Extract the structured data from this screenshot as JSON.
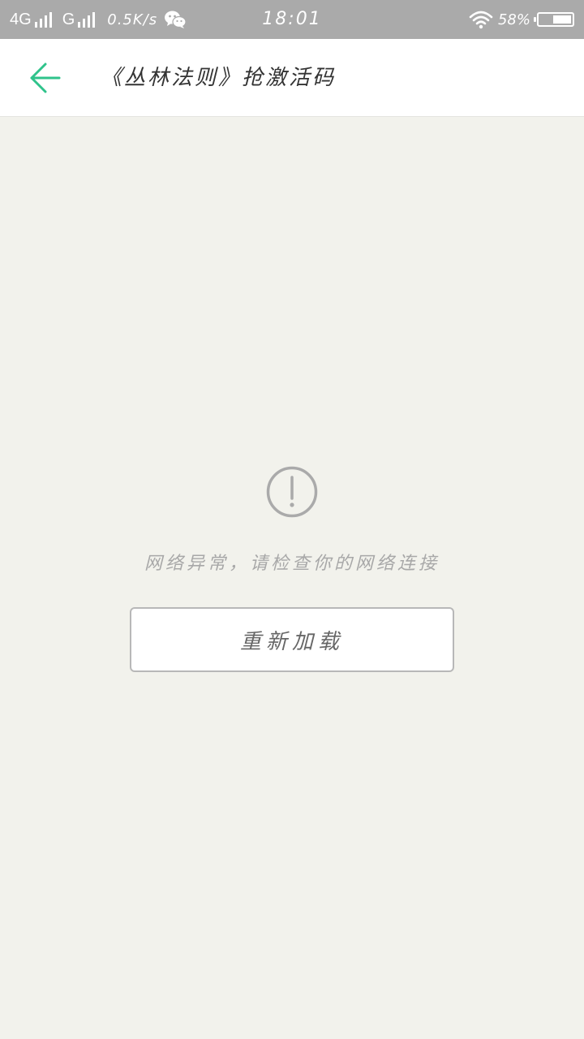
{
  "status_bar": {
    "network_1": "4G",
    "network_2": "G",
    "net_speed": "0.5K/s",
    "time": "18:01",
    "battery_percent": "58%",
    "battery_level": 0.58,
    "icons": [
      "signal-icon",
      "wechat-icon",
      "wifi-icon",
      "battery-icon"
    ]
  },
  "header": {
    "title": "《丛林法则》抢激活码",
    "back_icon": "back-arrow-icon",
    "accent_color": "#2fc38b"
  },
  "error": {
    "icon": "exclamation-circle-icon",
    "message": "网络异常，请检查你的网络连接",
    "reload_label": "重新加载"
  }
}
